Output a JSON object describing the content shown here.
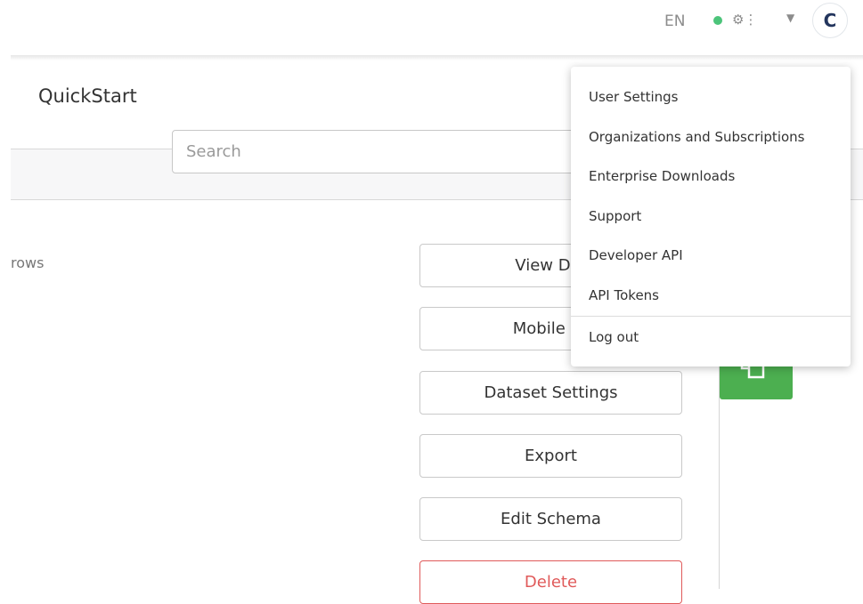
{
  "header": {
    "language": "EN",
    "status_color": "#4cc47a",
    "settings_icon": "gear-icon",
    "avatar_initial": "C"
  },
  "page": {
    "title": "QuickStart",
    "search_placeholder": "Search",
    "rows_label": "rows"
  },
  "actions": [
    {
      "label": "View Dat"
    },
    {
      "label": "Mobile Fo"
    },
    {
      "label": "Dataset Settings"
    },
    {
      "label": "Export"
    },
    {
      "label": "Edit Schema"
    },
    {
      "label": "Delete"
    }
  ],
  "user_menu": {
    "items": [
      {
        "label": "User Settings"
      },
      {
        "label": "Organizations and Subscriptions"
      },
      {
        "label": "Enterprise Downloads"
      },
      {
        "label": "Support"
      },
      {
        "label": "Developer API"
      },
      {
        "label": "API Tokens"
      }
    ],
    "logout_label": "Log out"
  },
  "colors": {
    "danger": "#e05a5a",
    "accent_green": "#4caf50",
    "avatar_text": "#23355d"
  }
}
